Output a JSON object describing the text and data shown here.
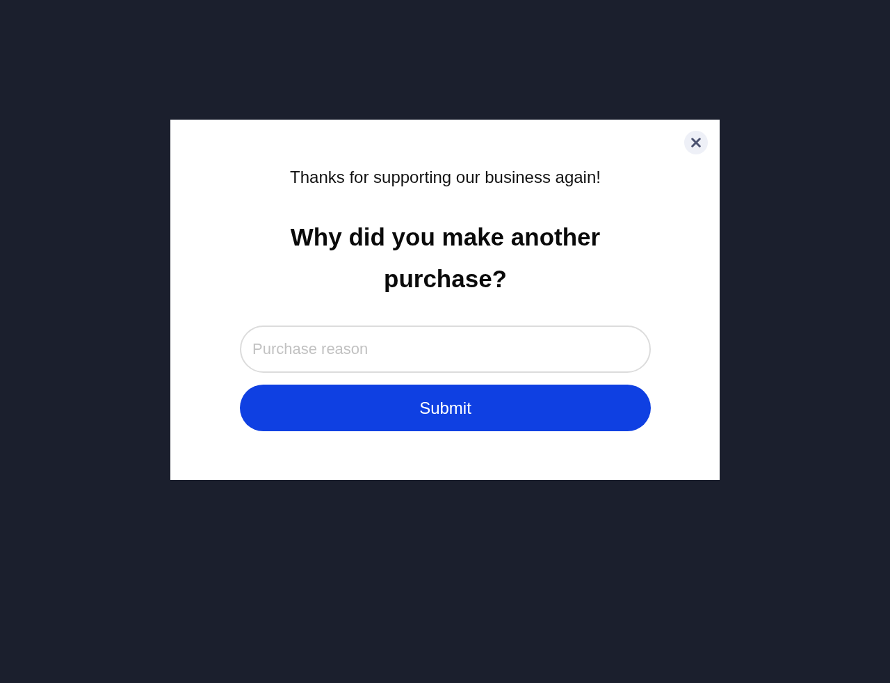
{
  "dialog": {
    "subtitle": "Thanks for supporting our business again!",
    "heading": "Why did you make another purchase?",
    "input": {
      "placeholder": "Purchase reason"
    },
    "submit_button": "Submit"
  }
}
